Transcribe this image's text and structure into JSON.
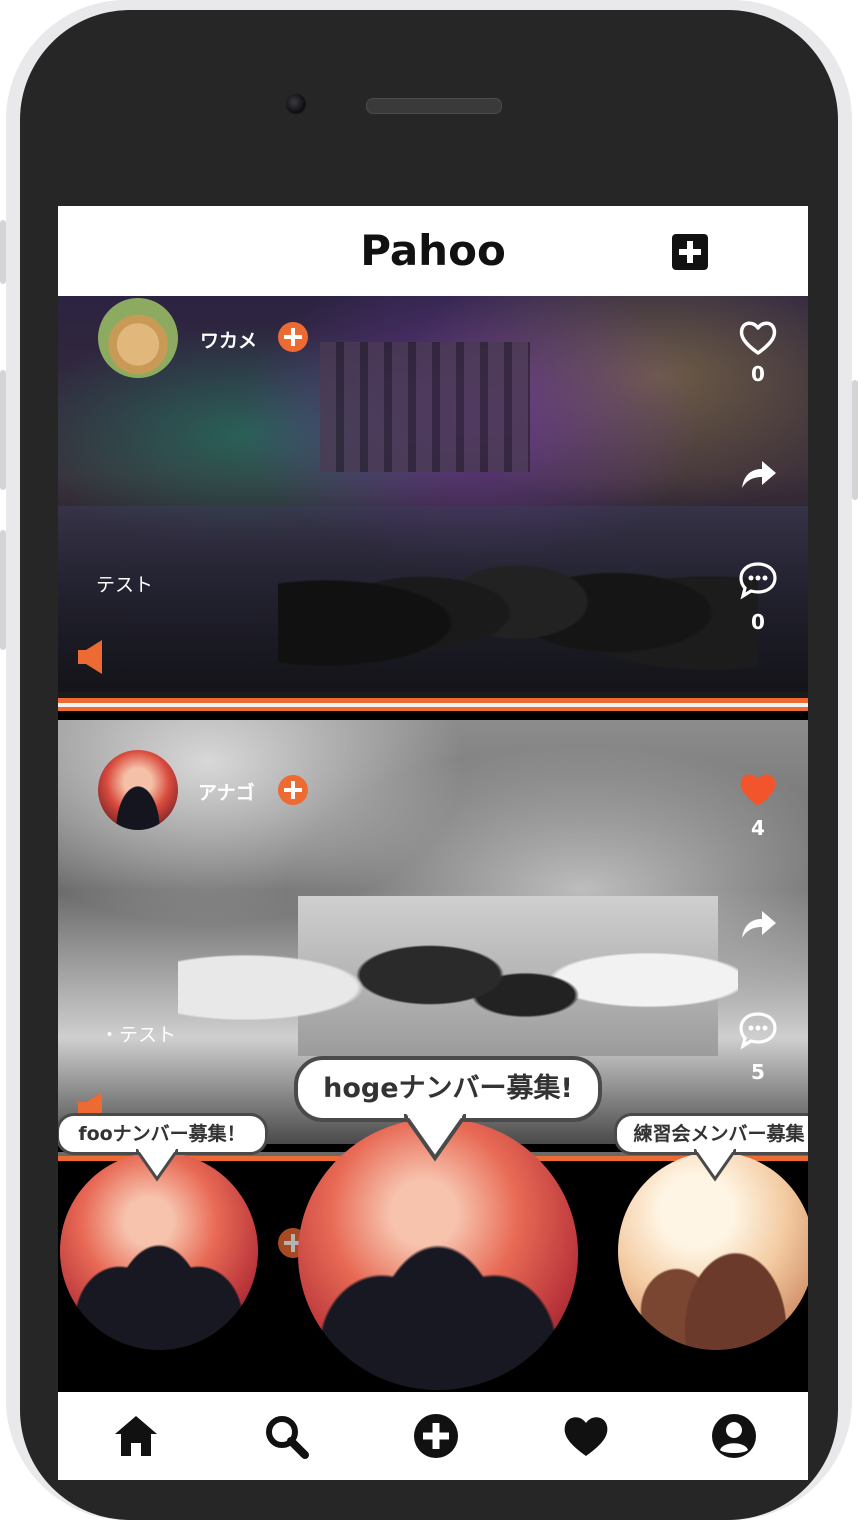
{
  "app": {
    "title": "Pahoo"
  },
  "colors": {
    "accent": "#ed6a32",
    "like": "#f2552c",
    "ink": "#111111"
  },
  "posts": [
    {
      "username": "ワカメ",
      "caption": "テスト",
      "likes": "0",
      "comments": "0",
      "liked": false,
      "avatar_icon": "teddy-bear-avatar"
    },
    {
      "username": "アナゴ",
      "caption": "・テスト",
      "likes": "4",
      "comments": "5",
      "liked": true,
      "avatar_icon": "concert-crowd-avatar"
    }
  ],
  "recruit_bubbles": [
    {
      "label": "fooナンバー募集！"
    },
    {
      "label": "hogeナンバー募集!"
    },
    {
      "label": "練習会メンバー募集"
    }
  ],
  "bottom_nav": [
    {
      "name": "home",
      "icon": "home-icon"
    },
    {
      "name": "search",
      "icon": "search-icon"
    },
    {
      "name": "add",
      "icon": "add-circle-icon"
    },
    {
      "name": "favorites",
      "icon": "heart-icon"
    },
    {
      "name": "profile",
      "icon": "user-circle-icon"
    }
  ]
}
